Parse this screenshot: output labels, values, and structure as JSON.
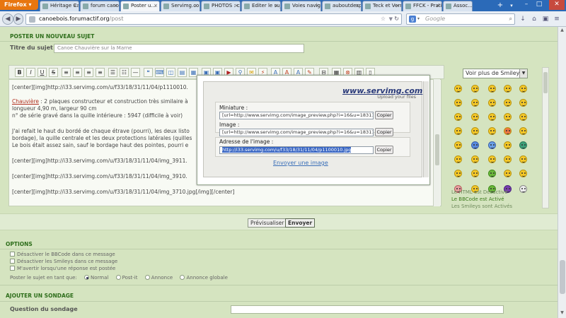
{
  "browser": {
    "app_menu": "Firefox",
    "tabs": [
      {
        "label": "Héritage Ca..."
      },
      {
        "label": "forum cano..."
      },
      {
        "label": "Poster u..."
      },
      {
        "label": "Servimg.co..."
      },
      {
        "label": "PHOTOS : c..."
      },
      {
        "label": "Editer le sujet"
      },
      {
        "label": "Voies navig..."
      },
      {
        "label": "auboutdesp..."
      },
      {
        "label": "Teck et Vernis"
      },
      {
        "label": "FFCK - Prati..."
      },
      {
        "label": "Assoc..."
      }
    ],
    "url_host": "canoebois.forumactif.org",
    "url_path": "/post",
    "search_placeholder": "Google",
    "search_engine_letter": "g"
  },
  "form": {
    "section_title": "POSTER UN NOUVEAU SUJET",
    "subject_label": "Titre du sujet :",
    "subject_value": "Canoe Chauvière sur la Marne"
  },
  "toolbar": {
    "buttons": [
      "B",
      "I",
      "U",
      "S"
    ]
  },
  "editor": {
    "lines": [
      "[center][img]http://i33.servimg.com/u/f33/18/31/11/04/p1110010.",
      "Chauvière",
      " : 2 plaques constructeur et construction très similaire à",
      "longueur 4,90 m, largeur 90 cm",
      "n° de série gravé dans la quille intérieure : 5947 (difficile à voir)",
      "J'ai refait le haut du bordé de chaque étrave (pourri), les deux listo",
      "bordage), la quille centrale et les deux protections latérales (quilles",
      "Le bois était assez sain, sauf le bordage haut des pointes, pourri e",
      "[center][img]http://i33.servimg.com/u/f33/18/31/11/04/img_3911.",
      "[center][img]http://i33.servimg.com/u/f33/18/31/11/04/img_3910.",
      "[center][img]http://i33.servimg.com/u/f33/18/31/11/04/img_3710.jpg[/img][/center]"
    ]
  },
  "servimg_popup": {
    "brand": "www.servimg.com",
    "tagline": "Upload your files",
    "thumb_label": "Miniature :",
    "thumb_value": "[url=http://www.servimg.com/image_preview.php?i=16&u=18311104][img]",
    "image_label": "Image :",
    "image_value": "[url=http://www.servimg.com/image_preview.php?i=16&u=18311104][img]",
    "address_label": "Adresse de l'image :",
    "address_value": "http://i33.servimg.com/u/f33/18/31/11/04/p1100010.jpg",
    "copy_label": "Copier",
    "send_link": "Envoyer une image"
  },
  "smileys": {
    "select_value": "Voir plus de Smileys",
    "status": [
      "Le HTML est Désactivé",
      "Le BBCode est Activé",
      "Les Smileys sont Activés"
    ]
  },
  "actions": {
    "preview": "Prévisualiser",
    "send": "Envoyer"
  },
  "options": {
    "title": "OPTIONS",
    "checkboxes": [
      "Désactiver le BBCode dans ce message",
      "Désactiver les Smileys dans ce message",
      "M'avertir lorsqu'une réponse est postée"
    ],
    "post_as_label": "Poster le sujet en tant que:",
    "post_types": [
      "Normal",
      "Post-it",
      "Annonce",
      "Annonce globale"
    ],
    "selected_post_type": "Normal"
  },
  "poll": {
    "title": "AJOUTER UN SONDAGE",
    "question_label": "Question du sondage"
  }
}
